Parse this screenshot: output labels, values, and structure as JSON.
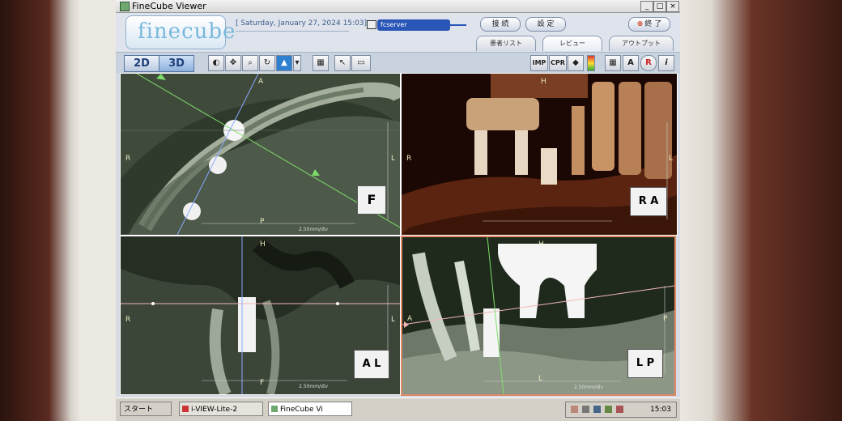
{
  "window": {
    "title": "FineCube Viewer"
  },
  "header": {
    "logo": "finecube",
    "date": "[ Saturday, January 27, 2024 15:03]",
    "server": "fcserver",
    "buttons": {
      "connect": "接 続",
      "settings": "設 定",
      "exit": "終 了"
    },
    "tabs": [
      "患者リスト",
      "レビュー",
      "アウトプット"
    ]
  },
  "toolbar": {
    "mode_2d": "2D",
    "mode_3d": "3D",
    "right_tools": [
      "IMP",
      "CPR"
    ]
  },
  "panes": {
    "axial": {
      "labels": {
        "top": "A",
        "left": "R",
        "right": "L",
        "bottom": "P"
      },
      "scale": "2.50mm/div",
      "cube": "F"
    },
    "volume": {
      "labels": {
        "top": "H",
        "left": "R",
        "right": "L"
      },
      "cube": "R A"
    },
    "coronal": {
      "labels": {
        "top": "H",
        "left": "R",
        "right": "L",
        "bottom": "F"
      },
      "scale": "2.50mm/div",
      "cube": "A L"
    },
    "sagittal": {
      "labels": {
        "top": "H",
        "left": "A",
        "right": "P",
        "bottom": "L"
      },
      "scale": "2.50mm/div",
      "cube": "L P"
    }
  },
  "taskbar": {
    "start": "スタート",
    "tasks": [
      "i-VIEW-Lite-2",
      "FineCube Vi"
    ],
    "clock": "15:03"
  }
}
